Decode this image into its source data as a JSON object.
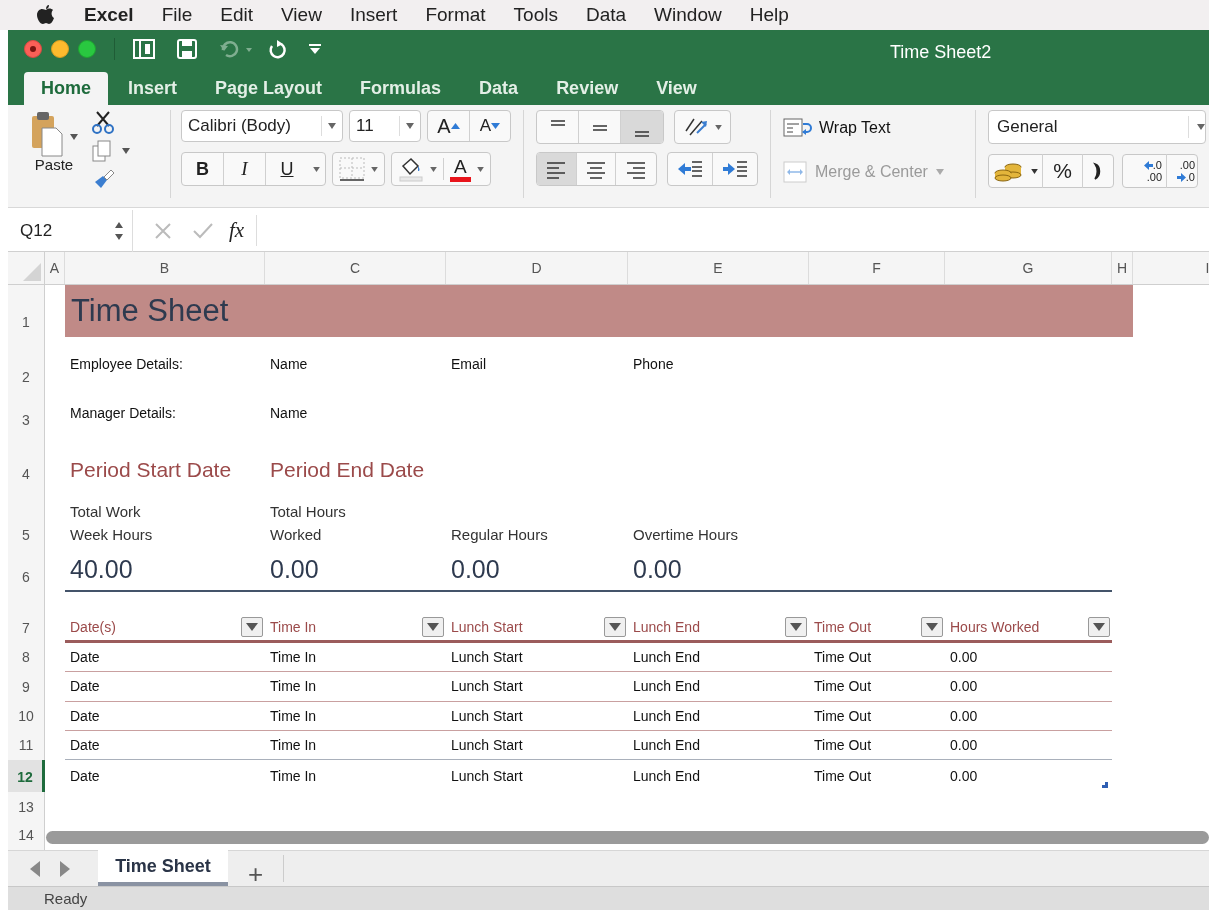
{
  "menu_bar": {
    "items": [
      {
        "label": "Excel",
        "app": true
      },
      {
        "label": "File",
        "app": false
      },
      {
        "label": "Edit",
        "app": false
      },
      {
        "label": "View",
        "app": false
      },
      {
        "label": "Insert",
        "app": false
      },
      {
        "label": "Format",
        "app": false
      },
      {
        "label": "Tools",
        "app": false
      },
      {
        "label": "Data",
        "app": false
      },
      {
        "label": "Window",
        "app": false
      },
      {
        "label": "Help",
        "app": false
      }
    ]
  },
  "window": {
    "title": "Time Sheet2"
  },
  "ribbon_tabs": [
    {
      "label": "Home",
      "selected": true
    },
    {
      "label": "Insert",
      "selected": false
    },
    {
      "label": "Page Layout",
      "selected": false
    },
    {
      "label": "Formulas",
      "selected": false
    },
    {
      "label": "Data",
      "selected": false
    },
    {
      "label": "Review",
      "selected": false
    },
    {
      "label": "View",
      "selected": false
    }
  ],
  "ribbon": {
    "paste": "Paste",
    "font": "Calibri (Body)",
    "font_size": "11",
    "grow_font": "A",
    "shrink_font": "A",
    "bold": "B",
    "italic": "I",
    "underline": "U",
    "font_color": "A",
    "vertical_align": [
      {
        "selected": false
      },
      {
        "selected": false
      },
      {
        "selected": true
      }
    ],
    "horizontal_align": [
      {
        "selected": true
      },
      {
        "selected": false
      },
      {
        "selected": false
      }
    ],
    "wrap_text": "Wrap Text",
    "merge": {
      "label": "Merge & Center",
      "disabled": true
    },
    "number_format": "General",
    "percent": "%",
    "increase_decimal": [
      ".0",
      ".00"
    ],
    "decrease_decimal": [
      ".00",
      ".0"
    ]
  },
  "formula_bar": {
    "name_box": "Q12",
    "function_label": "fx"
  },
  "columns": [
    {
      "label": "A"
    },
    {
      "label": "B"
    },
    {
      "label": "C"
    },
    {
      "label": "D"
    },
    {
      "label": "E"
    },
    {
      "label": "F"
    },
    {
      "label": "G"
    },
    {
      "label": "H"
    },
    {
      "label": "I"
    }
  ],
  "rows": [
    {
      "number": "1",
      "selected": false,
      "cells": [
        {
          "text": "Time Sheet",
          "kind": "title"
        }
      ]
    },
    {
      "number": "2",
      "selected": false,
      "cells": [
        {
          "text": "Employee Details:",
          "kind": "label"
        },
        {
          "text": "Name",
          "kind": "label"
        },
        {
          "text": "Email",
          "kind": "label"
        },
        {
          "text": "Phone",
          "kind": "label"
        }
      ]
    },
    {
      "number": "3",
      "selected": false,
      "cells": [
        {
          "text": "Manager Details:",
          "kind": "label"
        },
        {
          "text": "Name",
          "kind": "label"
        }
      ]
    },
    {
      "number": "4",
      "selected": false,
      "cells": [
        {
          "text": "Period Start Date",
          "kind": "heading"
        },
        {
          "text": "Period End Date",
          "kind": "heading"
        }
      ]
    },
    {
      "number": "5",
      "selected": false,
      "cells": [
        {
          "text": "Total Work Week Hours",
          "kind": "wrap"
        },
        {
          "text": "Total Hours Worked",
          "kind": "wrap"
        },
        {
          "text": "Regular Hours",
          "kind": "subhead"
        },
        {
          "text": "Overtime Hours",
          "kind": "subhead"
        }
      ]
    },
    {
      "number": "6",
      "selected": false,
      "kind": "totals",
      "cells": [
        {
          "text": "40.00",
          "kind": "big"
        },
        {
          "text": "0.00",
          "kind": "big"
        },
        {
          "text": "0.00",
          "kind": "big"
        },
        {
          "text": "0.00",
          "kind": "big"
        }
      ]
    },
    {
      "number": "7",
      "selected": false,
      "kind": "table_header",
      "cells": [
        {
          "text": "Date(s)",
          "kind": "header"
        },
        {
          "text": "Time In",
          "kind": "header"
        },
        {
          "text": "Lunch Start",
          "kind": "header"
        },
        {
          "text": "Lunch End",
          "kind": "header"
        },
        {
          "text": "Time Out",
          "kind": "header"
        },
        {
          "text": "Hours Worked",
          "kind": "header"
        }
      ]
    },
    {
      "number": "8",
      "selected": false,
      "kind": "table_row",
      "cells": [
        {
          "text": "Date",
          "kind": "body"
        },
        {
          "text": "Time In",
          "kind": "body"
        },
        {
          "text": "Lunch Start",
          "kind": "body"
        },
        {
          "text": "Lunch End",
          "kind": "body"
        },
        {
          "text": "Time Out",
          "kind": "body"
        },
        {
          "text": "0.00",
          "kind": "body"
        }
      ]
    },
    {
      "number": "9",
      "selected": false,
      "kind": "table_row",
      "cells": [
        {
          "text": "Date",
          "kind": "body"
        },
        {
          "text": "Time In",
          "kind": "body"
        },
        {
          "text": "Lunch Start",
          "kind": "body"
        },
        {
          "text": "Lunch End",
          "kind": "body"
        },
        {
          "text": "Time Out",
          "kind": "body"
        },
        {
          "text": "0.00",
          "kind": "body"
        }
      ]
    },
    {
      "number": "10",
      "selected": false,
      "kind": "table_row",
      "cells": [
        {
          "text": "Date",
          "kind": "body"
        },
        {
          "text": "Time In",
          "kind": "body"
        },
        {
          "text": "Lunch Start",
          "kind": "body"
        },
        {
          "text": "Lunch End",
          "kind": "body"
        },
        {
          "text": "Time Out",
          "kind": "body"
        },
        {
          "text": "0.00",
          "kind": "body"
        }
      ]
    },
    {
      "number": "11",
      "selected": false,
      "kind": "table_row",
      "cells": [
        {
          "text": "Date",
          "kind": "body"
        },
        {
          "text": "Time In",
          "kind": "body"
        },
        {
          "text": "Lunch Start",
          "kind": "body"
        },
        {
          "text": "Lunch End",
          "kind": "body"
        },
        {
          "text": "Time Out",
          "kind": "body"
        },
        {
          "text": "0.00",
          "kind": "body"
        }
      ]
    },
    {
      "number": "12",
      "selected": true,
      "kind": "table_row",
      "table_end": true,
      "cells": [
        {
          "text": "Date",
          "kind": "body"
        },
        {
          "text": "Time In",
          "kind": "body"
        },
        {
          "text": "Lunch Start",
          "kind": "body"
        },
        {
          "text": "Lunch End",
          "kind": "body"
        },
        {
          "text": "Time Out",
          "kind": "body"
        },
        {
          "text": "0.00",
          "kind": "body"
        }
      ]
    },
    {
      "number": "13",
      "selected": false,
      "cells": []
    },
    {
      "number": "14",
      "selected": false,
      "cells": []
    }
  ],
  "sheet_tabs": [
    {
      "label": "Time Sheet",
      "selected": true
    }
  ],
  "add_sheet": "+",
  "status_bar": {
    "text": "Ready"
  }
}
